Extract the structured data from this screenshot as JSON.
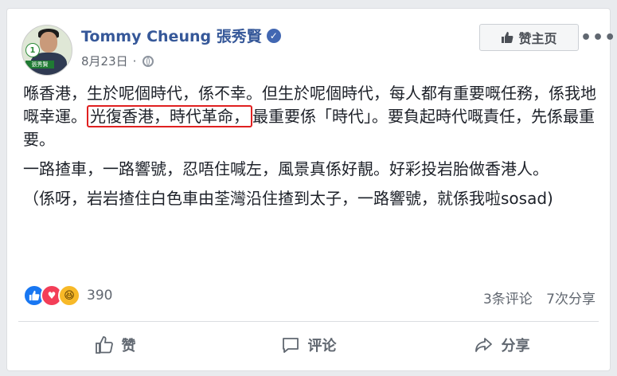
{
  "post": {
    "author": "Tommy Cheung 張秀賢",
    "date": "8月23日",
    "avatar_number": "1",
    "avatar_logo_text": "張秀賢",
    "follow_label": "赞主页",
    "paragraphs": [
      {
        "before": "喺香港，生於呢個時代，係不幸。但生於呢個時代，每人都有重要嘅任務，係我地嘅幸運。",
        "highlight": "光復香港，時代革命，",
        "after": "最重要係「時代」。要負起時代嘅責任，先係最重要。"
      },
      {
        "text": "一路揸車，一路響號，忍唔住喊左，風景真係好靚。好彩投岩胎做香港人。"
      },
      {
        "text": "（係呀，岩岩揸住白色車由荃灣沿住揸到太子，一路響號，就係我啦sosad)"
      }
    ]
  },
  "engagement": {
    "reaction_count": "390",
    "comments": "3条评论",
    "shares": "7次分享"
  },
  "actions": {
    "like": "赞",
    "comment": "评论",
    "share": "分享"
  },
  "colors": {
    "name_blue": "#365899",
    "highlight_border": "#e02020",
    "like_blue": "#1877f2",
    "love_red": "#f33e58",
    "haha_yellow": "#f7b928"
  },
  "icons": [
    "verified-badge-icon",
    "globe-icon",
    "more-options-icon",
    "like-thumb-icon",
    "comment-bubble-icon",
    "share-arrow-icon"
  ]
}
